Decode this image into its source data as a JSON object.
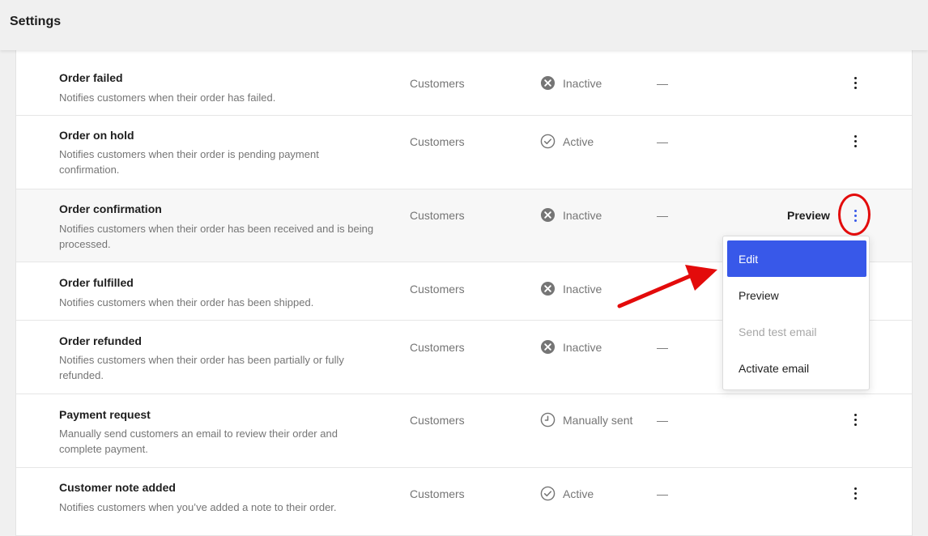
{
  "header": {
    "title": "Settings"
  },
  "emails": [
    {
      "name": "Order failed",
      "description": "Notifies customers when their order has failed.",
      "recipient": "Customers",
      "status": "Inactive",
      "status_icon": "x-circle-icon",
      "extra": "—"
    },
    {
      "name": "Order on hold",
      "description": "Notifies customers when their order is pending payment confirmation.",
      "recipient": "Customers",
      "status": "Active",
      "status_icon": "check-circle-icon",
      "extra": "—"
    },
    {
      "name": "Order confirmation",
      "description": "Notifies customers when their order has been received and is being processed.",
      "recipient": "Customers",
      "status": "Inactive",
      "status_icon": "x-circle-icon",
      "extra": "—",
      "preview_label": "Preview"
    },
    {
      "name": "Order fulfilled",
      "description": "Notifies customers when their order has been shipped.",
      "recipient": "Customers",
      "status": "Inactive",
      "status_icon": "x-circle-icon",
      "extra": ""
    },
    {
      "name": "Order refunded",
      "description": "Notifies customers when their order has been partially or fully refunded.",
      "recipient": "Customers",
      "status": "Inactive",
      "status_icon": "x-circle-icon",
      "extra": "—"
    },
    {
      "name": "Payment request",
      "description": "Manually send customers an email to review their order and complete payment.",
      "recipient": "Customers",
      "status": "Manually sent",
      "status_icon": "clock-icon",
      "extra": "—"
    },
    {
      "name": "Customer note added",
      "description": "Notifies customers when you’ve added a note to their order.",
      "recipient": "Customers",
      "status": "Active",
      "status_icon": "check-circle-icon",
      "extra": "—"
    }
  ],
  "dropdown": {
    "items": [
      {
        "label": "Edit",
        "state": "selected"
      },
      {
        "label": "Preview",
        "state": "normal"
      },
      {
        "label": "Send test email",
        "state": "disabled"
      },
      {
        "label": "Activate email",
        "state": "normal"
      }
    ]
  },
  "colors": {
    "accent": "#3858e9",
    "annotation_red": "#e30b0b",
    "muted_text": "#757575"
  }
}
